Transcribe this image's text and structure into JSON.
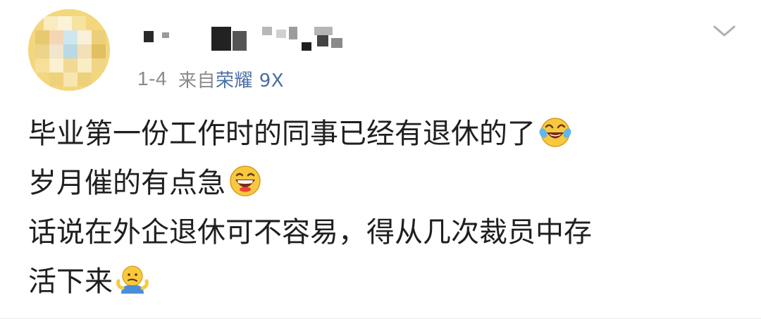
{
  "post": {
    "meta": {
      "date": "1-4",
      "from_label": "来自",
      "device": "荣耀 9X"
    },
    "content_lines": [
      "毕业第一份工作时的同事已经有退休的了",
      "岁月催的有点急",
      "话说在外企退休可不容易，得从几次裁员中存",
      "活下来"
    ],
    "emojis": [
      "laugh-cry-emoji",
      "grin-emoji",
      "shrug-emoji"
    ]
  },
  "colors": {
    "text": "#1f1f1f",
    "meta_gray": "#8a8a8a",
    "link_blue": "#4a6ea3",
    "avatar_yellow": "#f5d77a"
  }
}
